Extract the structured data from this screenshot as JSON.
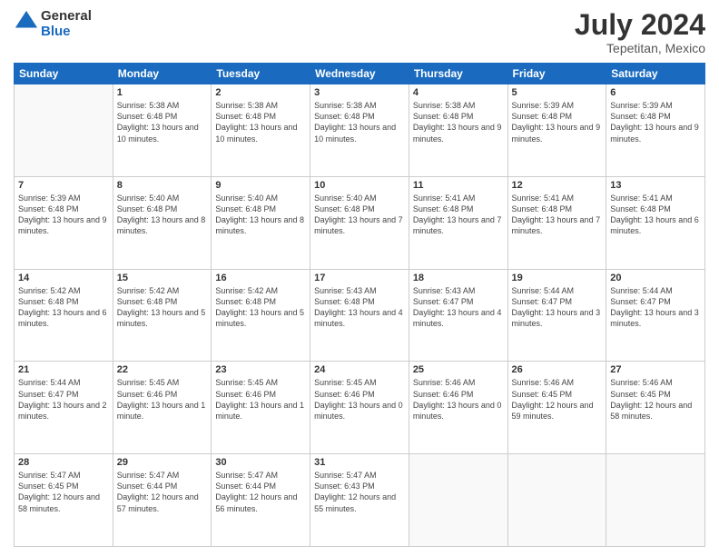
{
  "logo": {
    "general": "General",
    "blue": "Blue"
  },
  "title": "July 2024",
  "location": "Tepetitan, Mexico",
  "days_header": [
    "Sunday",
    "Monday",
    "Tuesday",
    "Wednesday",
    "Thursday",
    "Friday",
    "Saturday"
  ],
  "weeks": [
    [
      {
        "num": "",
        "sunrise": "",
        "sunset": "",
        "daylight": ""
      },
      {
        "num": "1",
        "sunrise": "Sunrise: 5:38 AM",
        "sunset": "Sunset: 6:48 PM",
        "daylight": "Daylight: 13 hours and 10 minutes."
      },
      {
        "num": "2",
        "sunrise": "Sunrise: 5:38 AM",
        "sunset": "Sunset: 6:48 PM",
        "daylight": "Daylight: 13 hours and 10 minutes."
      },
      {
        "num": "3",
        "sunrise": "Sunrise: 5:38 AM",
        "sunset": "Sunset: 6:48 PM",
        "daylight": "Daylight: 13 hours and 10 minutes."
      },
      {
        "num": "4",
        "sunrise": "Sunrise: 5:38 AM",
        "sunset": "Sunset: 6:48 PM",
        "daylight": "Daylight: 13 hours and 9 minutes."
      },
      {
        "num": "5",
        "sunrise": "Sunrise: 5:39 AM",
        "sunset": "Sunset: 6:48 PM",
        "daylight": "Daylight: 13 hours and 9 minutes."
      },
      {
        "num": "6",
        "sunrise": "Sunrise: 5:39 AM",
        "sunset": "Sunset: 6:48 PM",
        "daylight": "Daylight: 13 hours and 9 minutes."
      }
    ],
    [
      {
        "num": "7",
        "sunrise": "Sunrise: 5:39 AM",
        "sunset": "Sunset: 6:48 PM",
        "daylight": "Daylight: 13 hours and 9 minutes."
      },
      {
        "num": "8",
        "sunrise": "Sunrise: 5:40 AM",
        "sunset": "Sunset: 6:48 PM",
        "daylight": "Daylight: 13 hours and 8 minutes."
      },
      {
        "num": "9",
        "sunrise": "Sunrise: 5:40 AM",
        "sunset": "Sunset: 6:48 PM",
        "daylight": "Daylight: 13 hours and 8 minutes."
      },
      {
        "num": "10",
        "sunrise": "Sunrise: 5:40 AM",
        "sunset": "Sunset: 6:48 PM",
        "daylight": "Daylight: 13 hours and 7 minutes."
      },
      {
        "num": "11",
        "sunrise": "Sunrise: 5:41 AM",
        "sunset": "Sunset: 6:48 PM",
        "daylight": "Daylight: 13 hours and 7 minutes."
      },
      {
        "num": "12",
        "sunrise": "Sunrise: 5:41 AM",
        "sunset": "Sunset: 6:48 PM",
        "daylight": "Daylight: 13 hours and 7 minutes."
      },
      {
        "num": "13",
        "sunrise": "Sunrise: 5:41 AM",
        "sunset": "Sunset: 6:48 PM",
        "daylight": "Daylight: 13 hours and 6 minutes."
      }
    ],
    [
      {
        "num": "14",
        "sunrise": "Sunrise: 5:42 AM",
        "sunset": "Sunset: 6:48 PM",
        "daylight": "Daylight: 13 hours and 6 minutes."
      },
      {
        "num": "15",
        "sunrise": "Sunrise: 5:42 AM",
        "sunset": "Sunset: 6:48 PM",
        "daylight": "Daylight: 13 hours and 5 minutes."
      },
      {
        "num": "16",
        "sunrise": "Sunrise: 5:42 AM",
        "sunset": "Sunset: 6:48 PM",
        "daylight": "Daylight: 13 hours and 5 minutes."
      },
      {
        "num": "17",
        "sunrise": "Sunrise: 5:43 AM",
        "sunset": "Sunset: 6:48 PM",
        "daylight": "Daylight: 13 hours and 4 minutes."
      },
      {
        "num": "18",
        "sunrise": "Sunrise: 5:43 AM",
        "sunset": "Sunset: 6:47 PM",
        "daylight": "Daylight: 13 hours and 4 minutes."
      },
      {
        "num": "19",
        "sunrise": "Sunrise: 5:44 AM",
        "sunset": "Sunset: 6:47 PM",
        "daylight": "Daylight: 13 hours and 3 minutes."
      },
      {
        "num": "20",
        "sunrise": "Sunrise: 5:44 AM",
        "sunset": "Sunset: 6:47 PM",
        "daylight": "Daylight: 13 hours and 3 minutes."
      }
    ],
    [
      {
        "num": "21",
        "sunrise": "Sunrise: 5:44 AM",
        "sunset": "Sunset: 6:47 PM",
        "daylight": "Daylight: 13 hours and 2 minutes."
      },
      {
        "num": "22",
        "sunrise": "Sunrise: 5:45 AM",
        "sunset": "Sunset: 6:46 PM",
        "daylight": "Daylight: 13 hours and 1 minute."
      },
      {
        "num": "23",
        "sunrise": "Sunrise: 5:45 AM",
        "sunset": "Sunset: 6:46 PM",
        "daylight": "Daylight: 13 hours and 1 minute."
      },
      {
        "num": "24",
        "sunrise": "Sunrise: 5:45 AM",
        "sunset": "Sunset: 6:46 PM",
        "daylight": "Daylight: 13 hours and 0 minutes."
      },
      {
        "num": "25",
        "sunrise": "Sunrise: 5:46 AM",
        "sunset": "Sunset: 6:46 PM",
        "daylight": "Daylight: 13 hours and 0 minutes."
      },
      {
        "num": "26",
        "sunrise": "Sunrise: 5:46 AM",
        "sunset": "Sunset: 6:45 PM",
        "daylight": "Daylight: 12 hours and 59 minutes."
      },
      {
        "num": "27",
        "sunrise": "Sunrise: 5:46 AM",
        "sunset": "Sunset: 6:45 PM",
        "daylight": "Daylight: 12 hours and 58 minutes."
      }
    ],
    [
      {
        "num": "28",
        "sunrise": "Sunrise: 5:47 AM",
        "sunset": "Sunset: 6:45 PM",
        "daylight": "Daylight: 12 hours and 58 minutes."
      },
      {
        "num": "29",
        "sunrise": "Sunrise: 5:47 AM",
        "sunset": "Sunset: 6:44 PM",
        "daylight": "Daylight: 12 hours and 57 minutes."
      },
      {
        "num": "30",
        "sunrise": "Sunrise: 5:47 AM",
        "sunset": "Sunset: 6:44 PM",
        "daylight": "Daylight: 12 hours and 56 minutes."
      },
      {
        "num": "31",
        "sunrise": "Sunrise: 5:47 AM",
        "sunset": "Sunset: 6:43 PM",
        "daylight": "Daylight: 12 hours and 55 minutes."
      },
      {
        "num": "",
        "sunrise": "",
        "sunset": "",
        "daylight": ""
      },
      {
        "num": "",
        "sunrise": "",
        "sunset": "",
        "daylight": ""
      },
      {
        "num": "",
        "sunrise": "",
        "sunset": "",
        "daylight": ""
      }
    ]
  ]
}
